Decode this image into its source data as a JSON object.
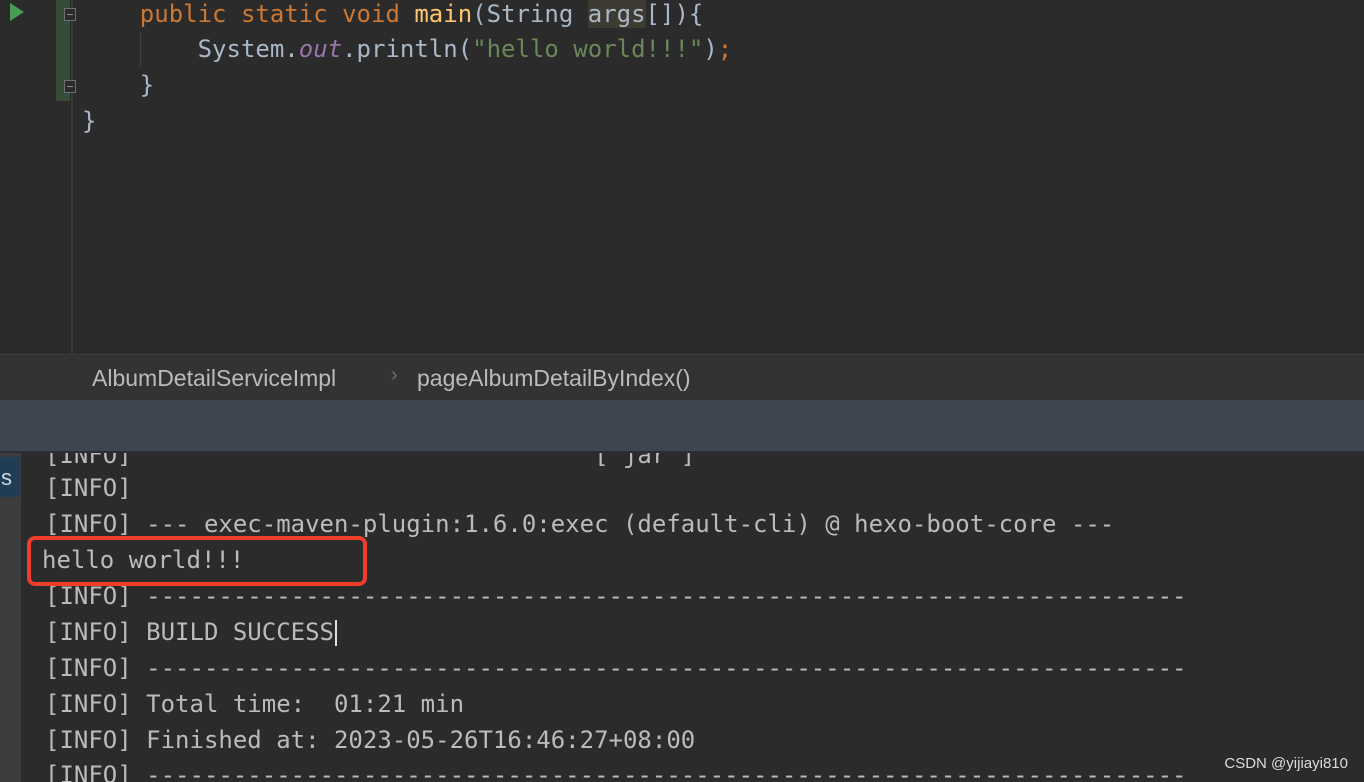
{
  "editor": {
    "lines": {
      "l1": {
        "kw1": "public",
        "kw2": "static",
        "kw3": "void",
        "method": "main",
        "open": "(String ",
        "param": "args",
        "close": "[]){"
      },
      "l2": {
        "pre": "System.",
        "field": "out",
        "mid": ".println(",
        "str": "\"hello world!!!\"",
        "paren": ")",
        "semi": ";"
      },
      "l3": "}",
      "l4": "}"
    }
  },
  "breadcrumb": {
    "class_name": "AlbumDetailServiceImpl",
    "separator": "›",
    "method_name": "pageAlbumDetailByIndex()"
  },
  "console": {
    "strip_tab_label": "s",
    "lines": [
      "[INFO]                                [ jar ]",
      "[INFO]",
      "[INFO] --- exec-maven-plugin:1.6.0:exec (default-cli) @ hexo-boot-core ---",
      "hello world!!!",
      "[INFO] ------------------------------------------------------------------------",
      "[INFO] BUILD SUCCESS",
      "[INFO] ------------------------------------------------------------------------",
      "[INFO] Total time:  01:21 min",
      "[INFO] Finished at: 2023-05-26T16:46:27+08:00",
      "[INFO] ------------------------------------------------------------------------"
    ]
  },
  "annotation": {
    "highlight_color": "#ee3d2b"
  },
  "icons": {
    "run": "run-icon",
    "fold": "fold-icon"
  },
  "watermark": "CSDN @yijiayi810"
}
